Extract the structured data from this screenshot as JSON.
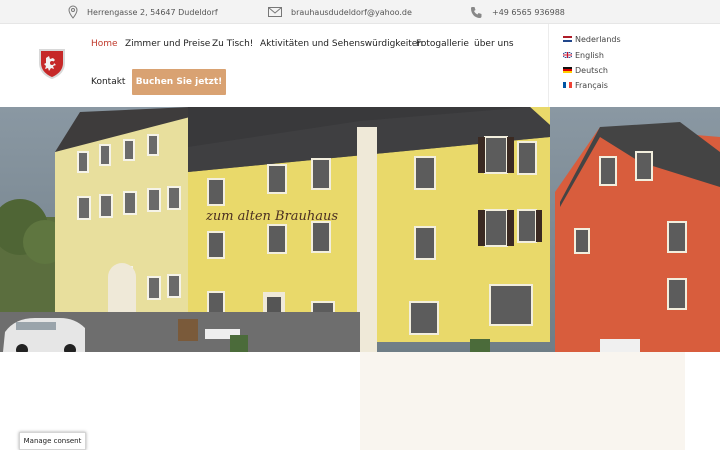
{
  "topbar": {
    "address": "Herrengasse 2, 54647 Dudeldorf",
    "email": "brauhausdudeldorf@yahoo.de",
    "phone": "+49 6565 936988"
  },
  "nav": {
    "items": [
      "Home",
      "Zimmer und Preise",
      "Zu Tisch!",
      "Aktivitäten und Sehenswürdigkeiten",
      "Fotogallerie",
      "über uns",
      "Kontakt"
    ],
    "book_label": "Buchen Sie jetzt!"
  },
  "languages": [
    "Nederlands",
    "English",
    "Deutsch",
    "Français"
  ],
  "hero": {
    "sign": "zum alten Brauhaus"
  },
  "consent": {
    "label": "Manage consent"
  },
  "colors": {
    "accent": "#d9a272",
    "active_nav": "#c0392b",
    "panel": "#f9f5ef"
  }
}
